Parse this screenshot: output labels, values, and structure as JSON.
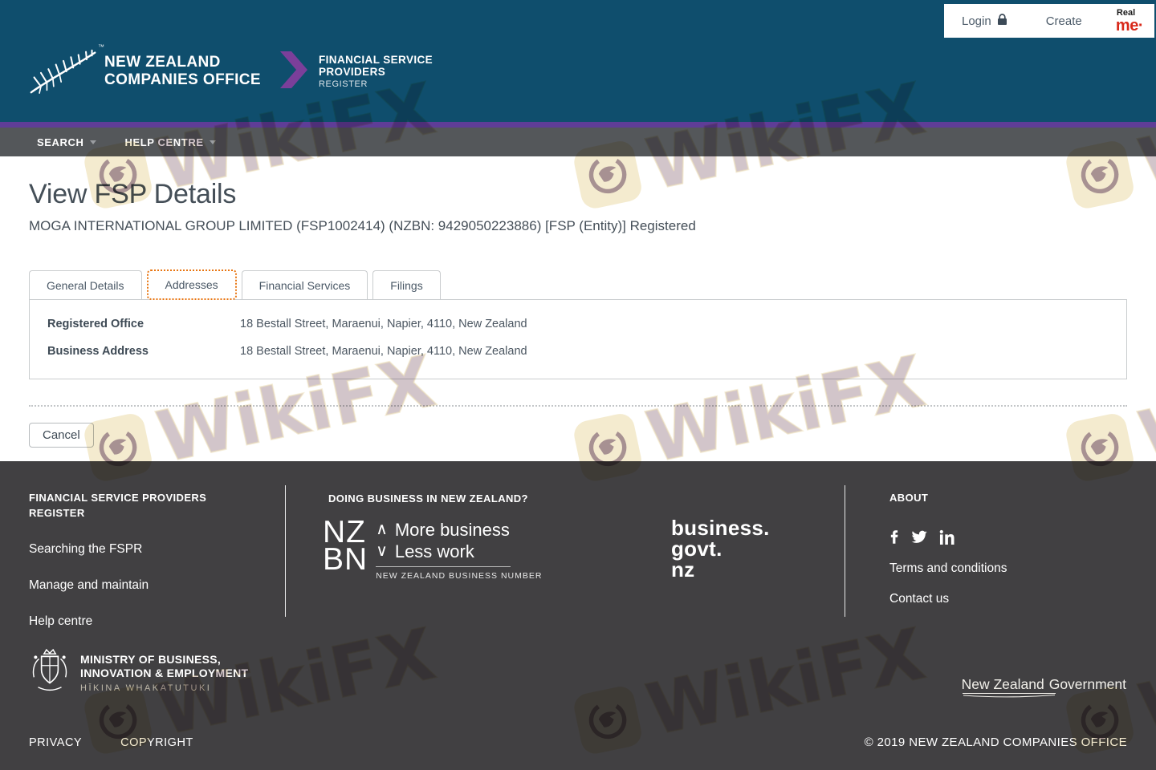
{
  "topbar": {
    "login": "Login",
    "create": "Create",
    "realme_top": "Real",
    "realme_bottom": "me"
  },
  "header": {
    "trademark": "™",
    "org1": "NEW ZEALAND",
    "org2": "COMPANIES OFFICE",
    "prod1": "FINANCIAL SERVICE",
    "prod2": "PROVIDERS",
    "prod3": "REGISTER"
  },
  "nav": {
    "items": [
      {
        "label": "SEARCH"
      },
      {
        "label": "HELP CENTRE"
      }
    ]
  },
  "page": {
    "title": "View FSP Details",
    "subtitle": "MOGA INTERNATIONAL GROUP LIMITED (FSP1002414) (NZBN: 9429050223886) [FSP (Entity)] Registered"
  },
  "tabs": [
    {
      "label": "General Details",
      "active": false
    },
    {
      "label": "Addresses",
      "active": true
    },
    {
      "label": "Financial Services",
      "active": false
    },
    {
      "label": "Filings",
      "active": false
    }
  ],
  "details": {
    "rows": [
      {
        "label": "Registered Office",
        "value": "18 Bestall Street, Maraenui, Napier, 4110, New Zealand"
      },
      {
        "label": "Business Address",
        "value": "18 Bestall Street, Maraenui, Napier, 4110, New Zealand"
      }
    ]
  },
  "actions": {
    "cancel": "Cancel"
  },
  "footer": {
    "col1": {
      "heading": "FINANCIAL SERVICE PROVIDERS REGISTER",
      "links": [
        "Searching the FSPR",
        "Manage and maintain",
        "Help centre"
      ]
    },
    "col2": {
      "heading": "DOING BUSINESS IN NEW ZEALAND?",
      "nzbn": {
        "top": "NZ",
        "bottom": "BN",
        "up": "∧",
        "down": "∨",
        "more": "More business",
        "less": "Less work",
        "caption": "NEW ZEALAND BUSINESS NUMBER"
      },
      "bgn": [
        "business.",
        "govt.",
        "nz"
      ]
    },
    "col3": {
      "heading": "ABOUT",
      "social": [
        "facebook",
        "twitter",
        "linkedin"
      ],
      "links": [
        "Terms and conditions",
        "Contact us"
      ]
    },
    "mbie": {
      "line1": "MINISTRY OF BUSINESS,",
      "line2": "INNOVATION & EMPLOYMENT",
      "line3": "HĪKINA WHAKATUTUKI"
    },
    "govt": {
      "name": "New Zealand",
      "word": "Government"
    },
    "bottom": {
      "privacy": "PRIVACY",
      "copyright": "COPYRIGHT",
      "notice": "© 2019 NEW ZEALAND COMPANIES OFFICE"
    }
  },
  "watermark": {
    "text": "WikiFX"
  },
  "colors": {
    "header_blue": "#0f4e6d",
    "purple_strip": "#5f3d97",
    "nav_gray": "#54575a",
    "footer_gray": "#414042",
    "accent_orange": "#e87511",
    "realme_red": "#d8291a"
  }
}
